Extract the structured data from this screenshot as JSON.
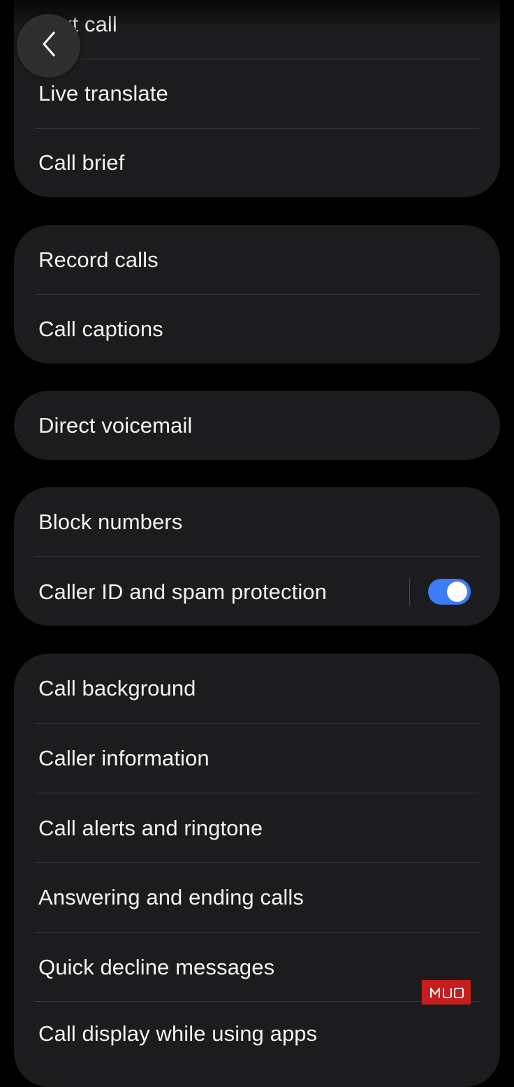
{
  "navigation": {
    "back_icon": "chevron-left-icon"
  },
  "group1": {
    "items": [
      {
        "label": "Text call"
      },
      {
        "label": "Live translate"
      },
      {
        "label": "Call brief"
      }
    ]
  },
  "group2": {
    "items": [
      {
        "label": "Record calls"
      },
      {
        "label": "Call captions"
      }
    ]
  },
  "group3": {
    "items": [
      {
        "label": "Direct voicemail"
      }
    ]
  },
  "group4": {
    "items": [
      {
        "label": "Block numbers"
      },
      {
        "label": "Caller ID and spam protection",
        "toggle_on": true
      }
    ]
  },
  "group5": {
    "items": [
      {
        "label": "Call background"
      },
      {
        "label": "Caller information"
      },
      {
        "label": "Call alerts and ringtone"
      },
      {
        "label": "Answering and ending calls"
      },
      {
        "label": "Quick decline messages"
      },
      {
        "label": "Call display while using apps"
      }
    ]
  },
  "watermark": {
    "logo": "MUO"
  },
  "colors": {
    "background": "#000000",
    "card": "#1c1c1e",
    "divider": "#3a3a3c",
    "toggle_on": "#3e7bf6",
    "text": "#f2f2f2",
    "watermark": "#c41e1e"
  }
}
